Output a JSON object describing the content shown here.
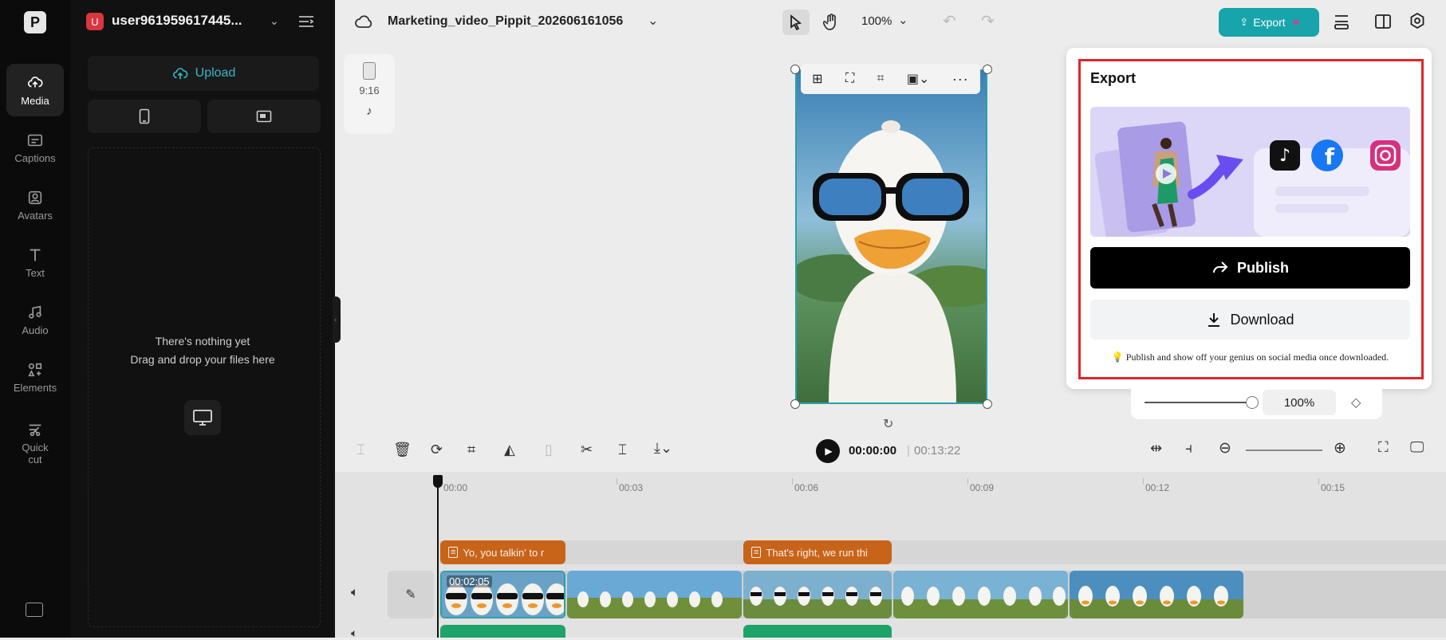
{
  "rail": {
    "logo": "P",
    "items": [
      {
        "label": "Media",
        "icon": "cloud-upload-icon"
      },
      {
        "label": "Captions",
        "icon": "captions-icon"
      },
      {
        "label": "Avatars",
        "icon": "avatar-icon"
      },
      {
        "label": "Text",
        "icon": "text-icon"
      },
      {
        "label": "Audio",
        "icon": "music-note-icon"
      },
      {
        "label": "Elements",
        "icon": "elements-icon"
      },
      {
        "label": "Quick cut",
        "icon": "scissors-icon"
      }
    ]
  },
  "account": {
    "badge": "U",
    "name": "user961959617445..."
  },
  "media_panel": {
    "upload_label": "Upload",
    "empty_line1": "There's nothing yet",
    "empty_line2": "Drag and drop your files here"
  },
  "topbar": {
    "project_title": "Marketing_video_Pippit_202606161056",
    "zoom": "100%",
    "export_label": "Export"
  },
  "ratio_chip": {
    "label": "9:16"
  },
  "export_popup": {
    "title": "Export",
    "publish_label": "Publish",
    "download_label": "Download",
    "tip": "Publish and show off your genius on social media once downloaded."
  },
  "zoom_control": {
    "value": "100%",
    "level": 0.9
  },
  "player": {
    "current": "00:00:00",
    "total": "00:13:22"
  },
  "timeline": {
    "ticks": [
      "00:00",
      "00:03",
      "00:06",
      "00:09",
      "00:12",
      "00:15"
    ],
    "caption_clips": [
      "Yo, you talkin' to r",
      "That's right, we run thi"
    ],
    "first_clip_time": "00:02:05"
  },
  "colors": {
    "accent": "#17a4ab",
    "highlight_frame": "#e1242d",
    "caption_clip": "#c8641a"
  }
}
